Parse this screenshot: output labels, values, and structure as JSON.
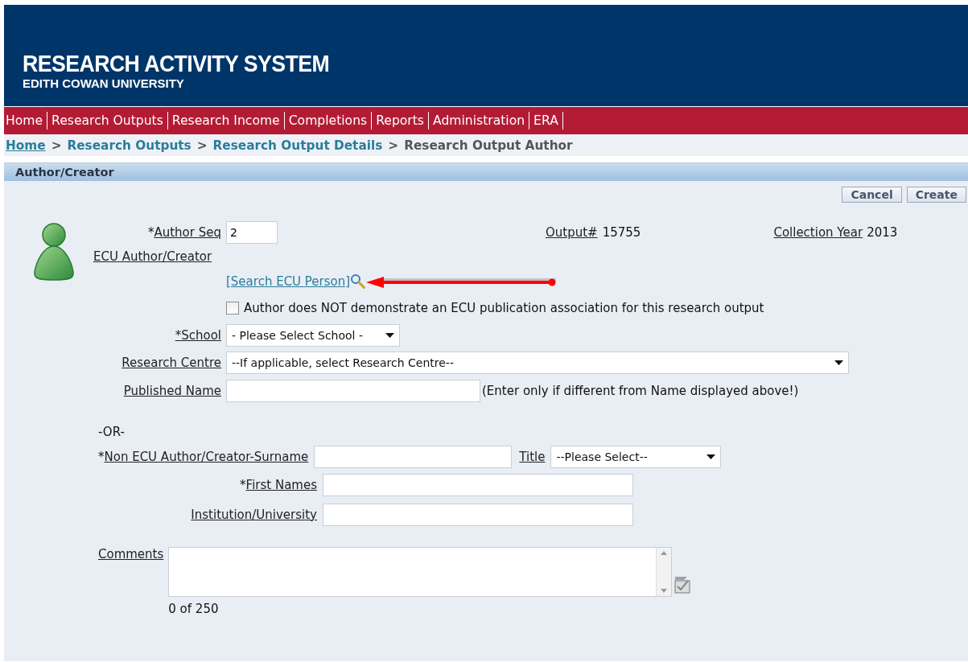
{
  "header": {
    "title": "RESEARCH ACTIVITY SYSTEM",
    "subtitle": "EDITH COWAN UNIVERSITY"
  },
  "nav": [
    {
      "label": "Home"
    },
    {
      "label": "Research Outputs"
    },
    {
      "label": "Research Income"
    },
    {
      "label": "Completions"
    },
    {
      "label": "Reports"
    },
    {
      "label": "Administration"
    },
    {
      "label": "ERA"
    }
  ],
  "breadcrumb": {
    "separator": ">",
    "items": [
      {
        "label": "Home",
        "underlined": true,
        "current": false
      },
      {
        "label": "Research Outputs",
        "underlined": false,
        "current": false
      },
      {
        "label": "Research Output Details",
        "underlined": false,
        "current": false
      },
      {
        "label": "Research Output Author",
        "underlined": false,
        "current": true
      }
    ]
  },
  "section": {
    "title": "Author/Creator"
  },
  "buttons": [
    "Cancel",
    "Create"
  ],
  "form": {
    "author_seq": {
      "mark": "*",
      "label": "Author Seq",
      "value": "2"
    },
    "output": {
      "label": "Output#",
      "value": "15755"
    },
    "collection_year": {
      "label": "Collection Year",
      "value": "2013"
    },
    "ecu_author": {
      "label": "ECU Author/Creator",
      "link": "[Search ECU Person]"
    },
    "no_association": {
      "label": "Author does NOT demonstrate an ECU publication association for this research output",
      "checked": false
    },
    "school": {
      "label": "*School",
      "value": "- Please Select School -"
    },
    "research_centre": {
      "label": "Research Centre",
      "value": "--If applicable, select Research Centre--"
    },
    "published_name": {
      "label": "Published Name",
      "note": "(Enter only if different from Name displayed above!)"
    },
    "or": "-OR-",
    "surname": {
      "mark": "*",
      "label": "Non ECU Author/Creator-Surname"
    },
    "title": {
      "label": "Title",
      "value": "--Please Select--"
    },
    "first_names": {
      "mark": "*",
      "label": "First Names"
    },
    "institution": {
      "label": "Institution/University"
    },
    "comments": {
      "label": "Comments",
      "counter": "0 of 250"
    }
  }
}
